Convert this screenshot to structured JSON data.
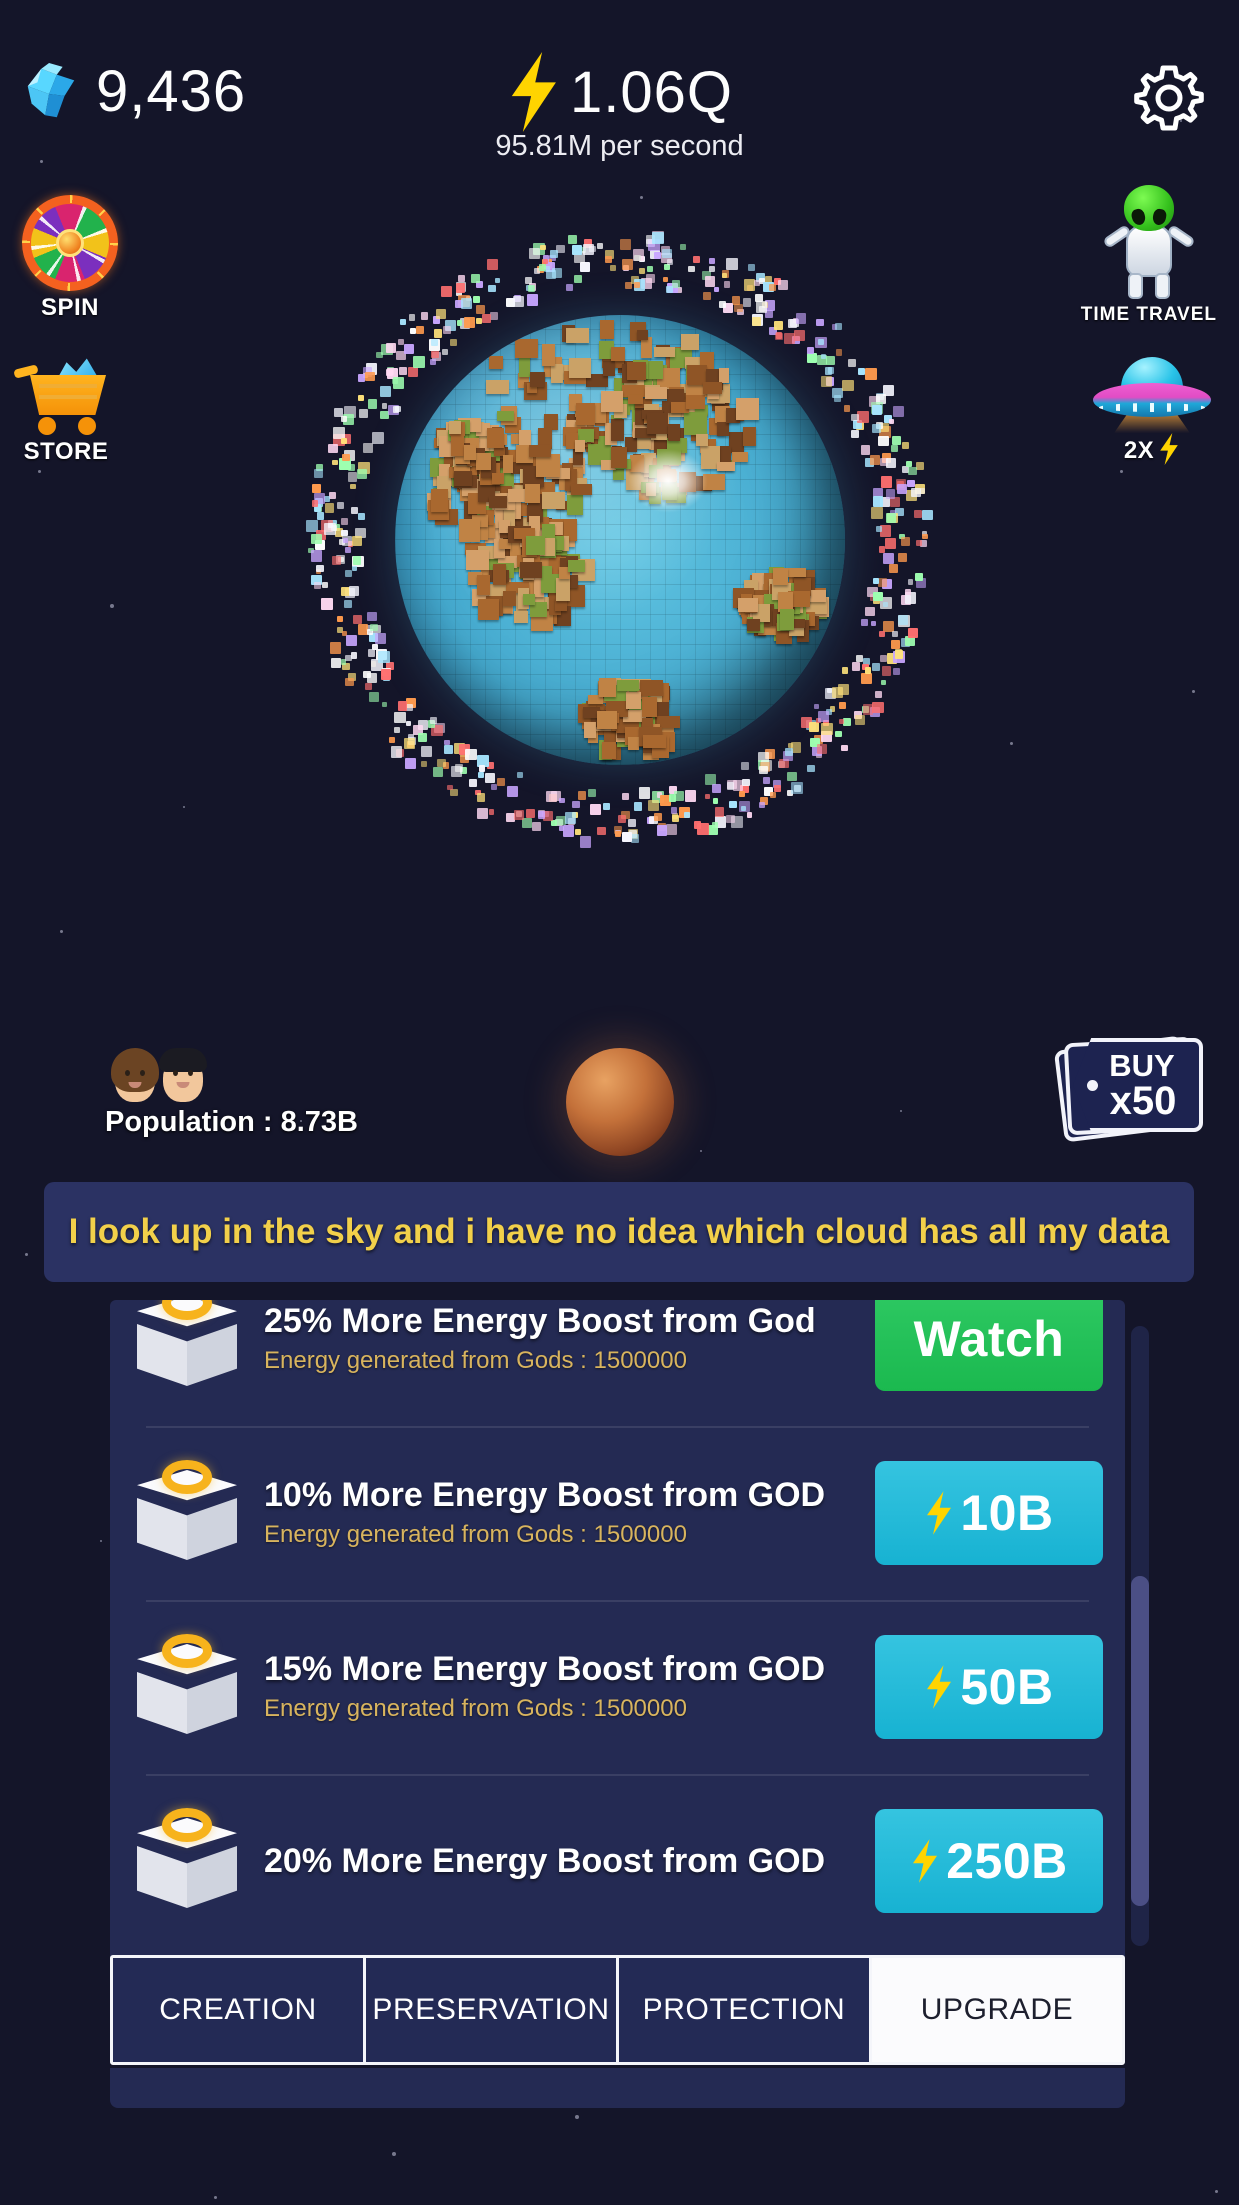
{
  "hud": {
    "gem_icon": "crystal-icon",
    "gem_count": "9,436",
    "energy_icon": "lightning-bolt-icon",
    "energy_total": "1.06Q",
    "energy_rate": "95.81M per second",
    "settings_icon": "gear-icon"
  },
  "side_left": [
    {
      "name": "spin",
      "icon": "fortune-wheel-icon",
      "label": "SPIN"
    },
    {
      "name": "store",
      "icon": "shopping-cart-icon",
      "label": "STORE"
    }
  ],
  "side_right": [
    {
      "name": "time-travel",
      "icon": "alien-astronaut-icon",
      "label": "TIME TRAVEL"
    },
    {
      "name": "boost",
      "icon": "ufo-icon",
      "label": "2X"
    }
  ],
  "planet": {
    "main": "voxel-earth",
    "satellite": "mars-planet",
    "orbit": "particle-ring"
  },
  "population": {
    "icon": "two-people-icon",
    "label": "Population : 8.73B"
  },
  "buy_tag": {
    "icon": "price-tag-icon",
    "line1": "BUY",
    "line2": "x50"
  },
  "quote": {
    "text": "I look up in the sky and i have no idea which cloud has all my data"
  },
  "upgrades": [
    {
      "icon": "god-cube-icon",
      "title": "25% More Energy Boost from God",
      "subtitle": "Energy generated from Gods : 1500000",
      "cta_type": "watch",
      "cta_label": "Watch",
      "cta_icon": "play-badge-icon"
    },
    {
      "icon": "god-cube-icon",
      "title": "10% More Energy Boost from GOD",
      "subtitle": "Energy generated from Gods : 1500000",
      "cta_type": "buy",
      "cta_label": "10B",
      "cta_icon": "lightning-bolt-icon"
    },
    {
      "icon": "god-cube-icon",
      "title": "15% More Energy Boost from GOD",
      "subtitle": "Energy generated from Gods : 1500000",
      "cta_type": "buy",
      "cta_label": "50B",
      "cta_icon": "lightning-bolt-icon"
    },
    {
      "icon": "god-cube-icon",
      "title": "20% More Energy Boost from GOD",
      "subtitle": "",
      "cta_type": "buy",
      "cta_label": "250B",
      "cta_icon": "lightning-bolt-icon"
    }
  ],
  "tabs": [
    {
      "label": "CREATION",
      "active": false
    },
    {
      "label": "PRESERVATION",
      "active": false
    },
    {
      "label": "PROTECTION",
      "active": false
    },
    {
      "label": "UPGRADE",
      "active": true
    }
  ],
  "colors": {
    "background": "#141529",
    "panel": "#242a53",
    "quote_bg": "#2b3263",
    "quote_text": "#f2d04a",
    "accent_buy": "#17b2d2",
    "accent_watch": "#1bb94f",
    "gold": "#f7b31c",
    "subtitle": "#d8b45e"
  }
}
